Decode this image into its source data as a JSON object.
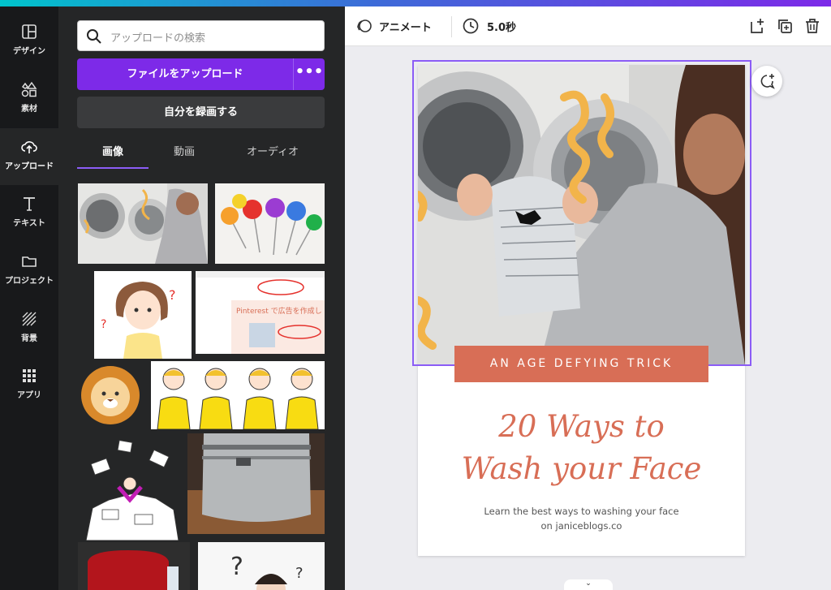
{
  "rail": {
    "items": [
      {
        "label": "デザイン",
        "icon": "layout-icon"
      },
      {
        "label": "素材",
        "icon": "shapes-icon"
      },
      {
        "label": "アップロード",
        "icon": "upload-cloud-icon",
        "active": true
      },
      {
        "label": "テキスト",
        "icon": "text-icon"
      },
      {
        "label": "プロジェクト",
        "icon": "folder-icon"
      },
      {
        "label": "背景",
        "icon": "background-pattern-icon"
      },
      {
        "label": "アプリ",
        "icon": "apps-grid-icon"
      }
    ]
  },
  "panel": {
    "search_placeholder": "アップロードの検索",
    "upload_label": "ファイルをアップロード",
    "more_label": "•••",
    "record_label": "自分を録画する",
    "tabs": [
      {
        "label": "画像",
        "active": true
      },
      {
        "label": "動画"
      },
      {
        "label": "オーディオ"
      }
    ],
    "thumb_text": {
      "pinterest_text": "Pinterest で広告を作成し",
      "question_mark": "?"
    }
  },
  "toolbar": {
    "animate_label": "アニメート",
    "duration_label": "5.0秒"
  },
  "design": {
    "banner": "AN AGE DEFYING TRICK",
    "headline_1": "20 Ways to",
    "headline_2": "Wash your Face",
    "sub_1": "Learn the best ways to washing your face",
    "sub_2": "on janiceblogs.co"
  },
  "colors": {
    "accent_purple": "#7d2ae8",
    "brand_orange": "#d86e56",
    "rail_bg": "#18191b",
    "panel_bg": "#252627"
  }
}
